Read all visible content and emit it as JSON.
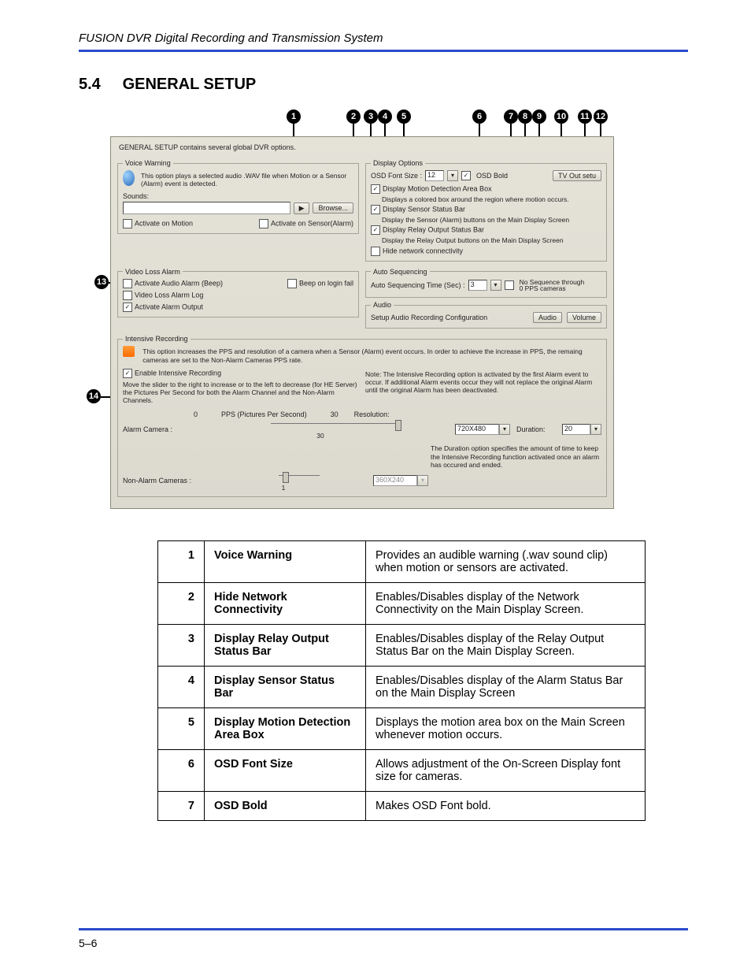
{
  "header": {
    "title": "FUSION DVR Digital Recording and Transmission System"
  },
  "section": {
    "number": "5.4",
    "title": "GENERAL SETUP"
  },
  "callouts": [
    "1",
    "2",
    "3",
    "4",
    "5",
    "6",
    "7",
    "8",
    "9",
    "10",
    "11",
    "12",
    "13",
    "14"
  ],
  "dialog": {
    "intro": "GENERAL SETUP contains several global DVR options.",
    "voice_warning": {
      "legend": "Voice Warning",
      "desc": "This option plays a selected audio .WAV file when Motion or a Sensor (Alarm) event is detected.",
      "sounds": "Sounds:",
      "play": "▶",
      "browse": "Browse...",
      "activate_motion": "Activate on Motion",
      "activate_sensor": "Activate on Sensor(Alarm)"
    },
    "display": {
      "legend": "Display Options",
      "osd_font": "OSD Font Size :",
      "osd_value": "12",
      "osd_bold": "OSD Bold",
      "tvout": "TV Out setu",
      "motion_box": "Display Motion Detection Area Box",
      "motion_box_desc": "Displays a colored box around the region where motion occurs.",
      "sensor_bar": "Display Sensor Status Bar",
      "sensor_bar_desc": "Display the Sensor (Alarm) buttons on the Main Display Screen",
      "relay_bar": "Display Relay Output Status Bar",
      "relay_bar_desc": "Display the Relay Output buttons on the Main Display Screen",
      "hide_net": "Hide network connectivity"
    },
    "video_loss": {
      "legend": "Video Loss Alarm",
      "audio": "Activate Audio Alarm (Beep)",
      "login_fail": "Beep on login fail",
      "log": "Video Loss Alarm Log",
      "output": "Activate Alarm Output"
    },
    "auto_seq": {
      "legend": "Auto Sequencing",
      "time": "Auto Sequencing Time (Sec) :",
      "val": "3",
      "nosq1": "No Sequence through",
      "nosq2": "0 PPS cameras"
    },
    "audio": {
      "legend": "Audio",
      "setup": "Setup Audio Recording Configuration",
      "audio_btn": "Audio",
      "volume_btn": "Volume"
    },
    "intensive": {
      "legend": "Intensive Recording",
      "desc": "This option increases the PPS and resolution of a camera when a Sensor (Alarm) event occurs. In order to achieve the increase in PPS, the remaing cameras are set to the Non-Alarm Cameras PPS rate.",
      "enable": "Enable Intensive Recording",
      "note": "Note: The Intensive Recording option is activated by the first Alarm event to occur. If additional Alarm events occur they will not replace the original Alarm until the original Alarm has been deactivated.",
      "slider_hint": "Move the slider to the right to increase or to the left to decrease (for HE Server) the Pictures Per Second for both the Alarm Channel and the Non-Alarm Channels.",
      "pps_0": "0",
      "pps_label": "PPS (Pictures Per Second)",
      "pps_30": "30",
      "res": "Resolution:",
      "alarm_cam": "Alarm Camera :",
      "alarm_val": "30",
      "alarm_res": "720X480",
      "duration": "Duration:",
      "dur_val": "20",
      "dur_note": "The Duration option specifies the amount of time to keep the Intensive Recording function activated once an alarm has occured and ended.",
      "non_alarm": "Non-Alarm Cameras :",
      "non_val": "1",
      "non_res": "360X240"
    }
  },
  "rows": [
    {
      "n": "1",
      "t": "Voice Warning",
      "d": "Provides an audible warning (.wav sound clip) when motion or sensors are activated."
    },
    {
      "n": "2",
      "t": "Hide Network Connectivity",
      "d": "Enables/Disables display of the Network Connectivity on the Main Display Screen."
    },
    {
      "n": "3",
      "t": "Display Relay Output Status Bar",
      "d": "Enables/Disables display of the Relay Output Status Bar on the Main Display Screen."
    },
    {
      "n": "4",
      "t": "Display Sensor Status Bar",
      "d": "Enables/Disables display of the Alarm Status Bar on the Main Display Screen"
    },
    {
      "n": "5",
      "t": "Display Motion Detection Area Box",
      "d": "Displays the motion area box on the Main Screen whenever motion occurs."
    },
    {
      "n": "6",
      "t": "OSD Font Size",
      "d": "Allows adjustment of the On-Screen Display font size for cameras."
    },
    {
      "n": "7",
      "t": "OSD Bold",
      "d": "Makes OSD Font bold."
    }
  ],
  "footer": {
    "page": "5–6"
  }
}
